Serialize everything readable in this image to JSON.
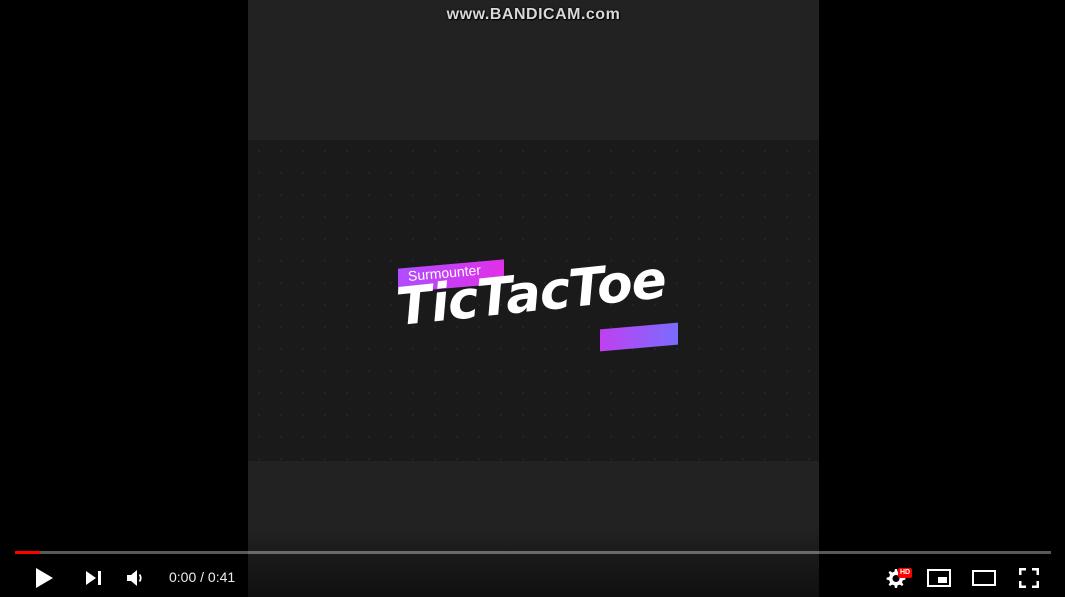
{
  "video": {
    "watermark": "www.BANDICAM.com",
    "logo": {
      "subtitle": "Surmounter",
      "title": "TicTacToe"
    }
  },
  "player": {
    "current_time": "0:00",
    "separator": " / ",
    "duration": "0:41",
    "progress_fraction": 0.024,
    "hd_label": "HD",
    "accent_color": "#ff0000"
  },
  "icons": {
    "play": "play-icon",
    "next": "next-icon",
    "volume": "volume-icon",
    "settings": "settings-gear-icon",
    "miniplayer": "miniplayer-icon",
    "theater": "theater-mode-icon",
    "fullscreen": "fullscreen-icon"
  }
}
